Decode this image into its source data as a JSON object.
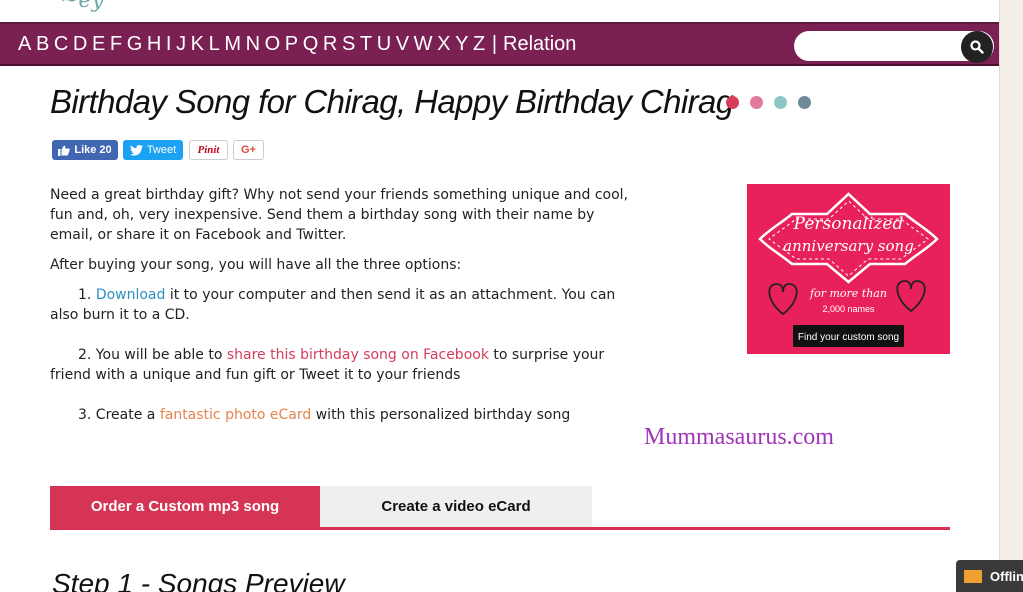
{
  "header": {
    "letters": [
      "A",
      "B",
      "C",
      "D",
      "E",
      "F",
      "G",
      "H",
      "I",
      "J",
      "K",
      "L",
      "M",
      "N",
      "O",
      "P",
      "Q",
      "R",
      "S",
      "T",
      "U",
      "V",
      "W",
      "X",
      "Y",
      "Z"
    ],
    "separator": "|",
    "relation_label": "Relation",
    "search_placeholder": ""
  },
  "title": "Birthday Song for Chirag, Happy Birthday Chirag",
  "title_dots_colors": [
    "#d63c5a",
    "#e07b9b",
    "#8cc7c6",
    "#6f8b98"
  ],
  "social": {
    "facebook_label": "Like 20",
    "twitter_label": "Tweet",
    "pinterest_label": "Pinit",
    "google_label": "G+"
  },
  "content": {
    "intro": "Need a great birthday gift? Why not send your friends something unique and cool, fun and, oh, very inexpensive. Send them a birthday song with their name by email, or share it on Facebook and Twitter.",
    "after": "After buying your song, you will have all the three options:",
    "item1_num": "1. ",
    "item1_link": "Download",
    "item1_rest": " it to your computer and then send it as an attachment. You can also burn it to a CD.",
    "item2_num": "2. You will be able to ",
    "item2_link": "share this birthday song on Facebook",
    "item2_rest": " to surprise your friend with a unique and fun gift or Tweet it to your friends",
    "item3_num": "3. Create a ",
    "item3_link": "fantastic photo eCard",
    "item3_rest": " with this personalized birthday song"
  },
  "ad": {
    "title_line1": "Personalized",
    "title_line2": "anniversary song",
    "sub_line1": "for more than",
    "sub_line2": "2,000 names",
    "button": "Find your custom song",
    "colors": {
      "background": "#e8215b"
    }
  },
  "watermark": "Mummasaurus.com",
  "tabs": [
    {
      "label": "Order a Custom mp3 song",
      "active": true
    },
    {
      "label": "Create a video eCard",
      "active": false
    }
  ],
  "step_heading": "Step 1 - Songs Preview",
  "chat_widget": {
    "label": "Offline"
  },
  "colors": {
    "header_bg": "#7a2052",
    "accent": "#d63455"
  }
}
